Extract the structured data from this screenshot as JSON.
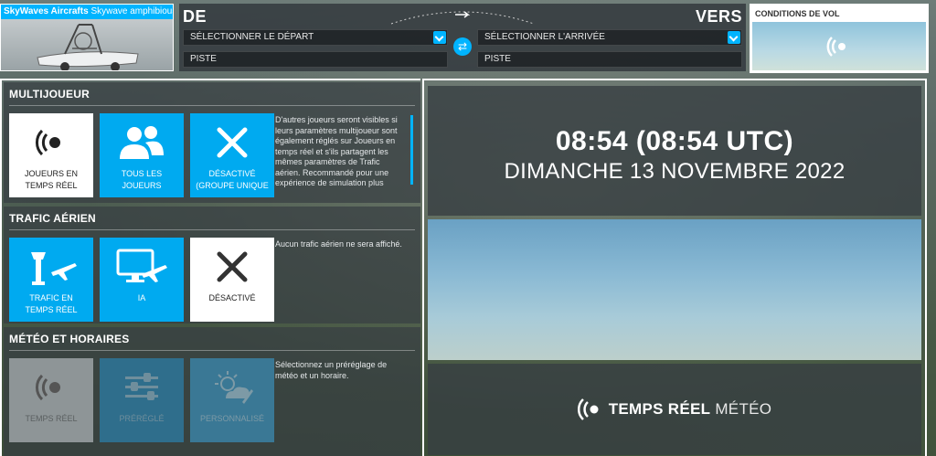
{
  "aircraft": {
    "maker": "SkyWaves Aircrafts",
    "model": "Skywave amphibious"
  },
  "route": {
    "from_label": "DE",
    "to_label": "VERS",
    "departure_placeholder": "SÉLECTIONNER LE DÉPART",
    "arrival_placeholder": "SÉLECTIONNER L'ARRIVÉE",
    "from_runway": "PISTE",
    "to_runway": "PISTE"
  },
  "flight_conditions": {
    "title": "CONDITIONS DE VOL"
  },
  "multiplayer": {
    "title": "MULTIJOUEUR",
    "options": [
      {
        "label": "JOUEURS EN\nTEMPS RÉEL",
        "icon": "live-signal-icon",
        "selected": true
      },
      {
        "label": "TOUS LES\nJOUEURS",
        "icon": "users-icon",
        "selected": false
      },
      {
        "label": "DÉSACTIVÉ\n(GROUPE UNIQUE",
        "icon": "close-icon",
        "selected": false
      }
    ],
    "description": "D'autres joueurs seront visibles si leurs paramètres multijoueur sont également réglés sur Joueurs en temps réel et s'ils partagent les mêmes paramètres de Trafic aérien. Recommandé pour une expérience de simulation plus"
  },
  "air_traffic": {
    "title": "TRAFIC AÉRIEN",
    "options": [
      {
        "label": "TRAFIC EN\nTEMPS RÉEL",
        "icon": "tower-plane-icon",
        "selected": false
      },
      {
        "label": "IA",
        "icon": "monitor-plane-icon",
        "selected": false
      },
      {
        "label": "DÉSACTIVÉ",
        "icon": "close-icon",
        "selected": true
      }
    ],
    "description": "Aucun trafic aérien ne sera affiché."
  },
  "weather_time": {
    "title": "MÉTÉO ET HORAIRES",
    "options": [
      {
        "label": "TEMPS RÉEL",
        "icon": "live-signal-icon",
        "selected": true
      },
      {
        "label": "PRÉRÉGLÉ",
        "icon": "sliders-icon",
        "selected": false
      },
      {
        "label": "PERSONNALISÉ",
        "icon": "sun-cloud-edit-icon",
        "selected": false
      }
    ],
    "description": "Sélectionnez un préréglage de météo et un horaire."
  },
  "time_panel": {
    "time": "08:54 (08:54 UTC)",
    "date": "DIMANCHE 13 NOVEMBRE 2022"
  },
  "live_weather": {
    "bold": "TEMPS RÉEL",
    "light": "MÉTÉO"
  },
  "colors": {
    "accent": "#00b4ff",
    "panel": "#373e42"
  }
}
